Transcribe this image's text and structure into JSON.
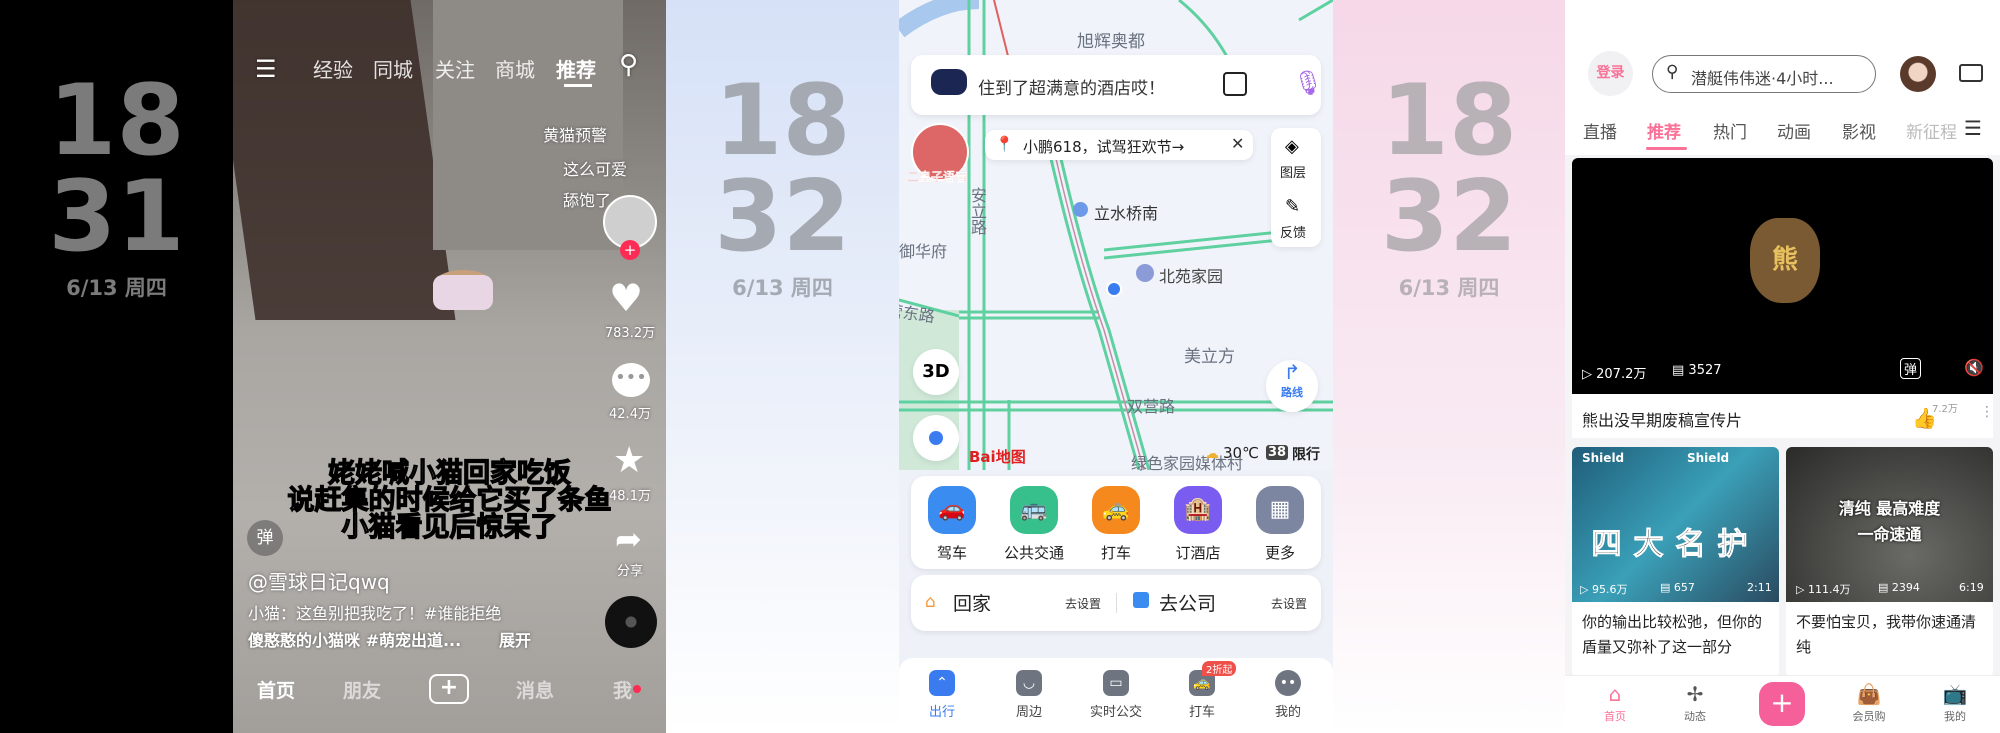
{
  "clocks": [
    {
      "hour": "18",
      "minute": "31",
      "date": "6/13 周四"
    },
    {
      "hour": "18",
      "minute": "32",
      "date": "6/13 周四"
    },
    {
      "hour": "18",
      "minute": "32",
      "date": "6/13 周四"
    }
  ],
  "douyin": {
    "tabs": [
      "经验",
      "同城",
      "关注",
      "商城",
      "推荐"
    ],
    "active_tab": "推荐",
    "comments": [
      "黄猫预警",
      "这么可爱",
      "舔饱了"
    ],
    "likes": "783.2万",
    "comments_count": "42.4万",
    "favorites": "48.1万",
    "share_label": "分享",
    "subtitles": [
      "姥姥喊小猫回家吃饭",
      "说赶集的时候给它买了条鱼",
      "小猫看见后惊呆了"
    ],
    "danmaku_label": "弹",
    "author": "@雪球日记qwq",
    "desc_line1": "小猫：这鱼别把我吃了！#谁能拒绝",
    "desc_line2": "傻憨憨的小猫咪 #萌宠出道...",
    "expand": "展开",
    "nav": [
      "首页",
      "朋友",
      "+",
      "消息",
      "我"
    ]
  },
  "baidu": {
    "search_text": "住到了超满意的酒店哎！",
    "voice_label": "二皇子语音",
    "promo": "小鹏618，试驾狂欢节→",
    "tools": [
      "图层",
      "反馈"
    ],
    "map_labels": [
      "旭辉奥都",
      "立水桥南",
      "安立路",
      "御华府",
      "北苑家园",
      "营东路",
      "美立方",
      "双营路",
      "绿色家园媒体村"
    ],
    "btn_3d": "3D",
    "route_label": "路线",
    "logo": "Bai地图",
    "temperature": "30℃",
    "restriction_nums": "38",
    "restriction_label": "限行",
    "services": [
      {
        "label": "驾车",
        "color": "#3a8cf0"
      },
      {
        "label": "公共交通",
        "color": "#38c08c"
      },
      {
        "label": "打车",
        "color": "#f5891e"
      },
      {
        "label": "订酒店",
        "color": "#7a5cf0"
      },
      {
        "label": "更多",
        "color": "#7d86a0"
      }
    ],
    "home": "回家",
    "work": "去公司",
    "set": "去设置",
    "nav": [
      "出行",
      "周边",
      "实时公交",
      "打车",
      "我的"
    ],
    "nav_badge": "2折起",
    "accent": "#3a7cf0"
  },
  "bili": {
    "login": "登录",
    "search_placeholder": "潜艇伟伟迷·4小时...",
    "tabs": [
      "直播",
      "推荐",
      "热门",
      "动画",
      "影视",
      "新征程"
    ],
    "active_tab": "推荐",
    "accent": "#fb7299",
    "featured": {
      "views": "207.2万",
      "danmaku": "3527",
      "title": "熊出没早期废稿宣传片",
      "likes": "7.2万",
      "logo_text": "熊出没",
      "danmaku_btn": "弹"
    },
    "cards": [
      {
        "overlay": "四大名护",
        "views": "95.6万",
        "danmaku": "657",
        "duration": "2:11",
        "title": "你的输出比较松弛，但你的盾量又弥补了这一部分",
        "tag": "Shield"
      },
      {
        "overlay1": "清纯 最高难度",
        "overlay2": "一命速通",
        "views": "111.4万",
        "danmaku": "2394",
        "duration": "6:19",
        "title": "不要怕宝贝，我带你速通清纯"
      }
    ],
    "nav": [
      "首页",
      "动态",
      "+",
      "会员购",
      "我的"
    ]
  }
}
